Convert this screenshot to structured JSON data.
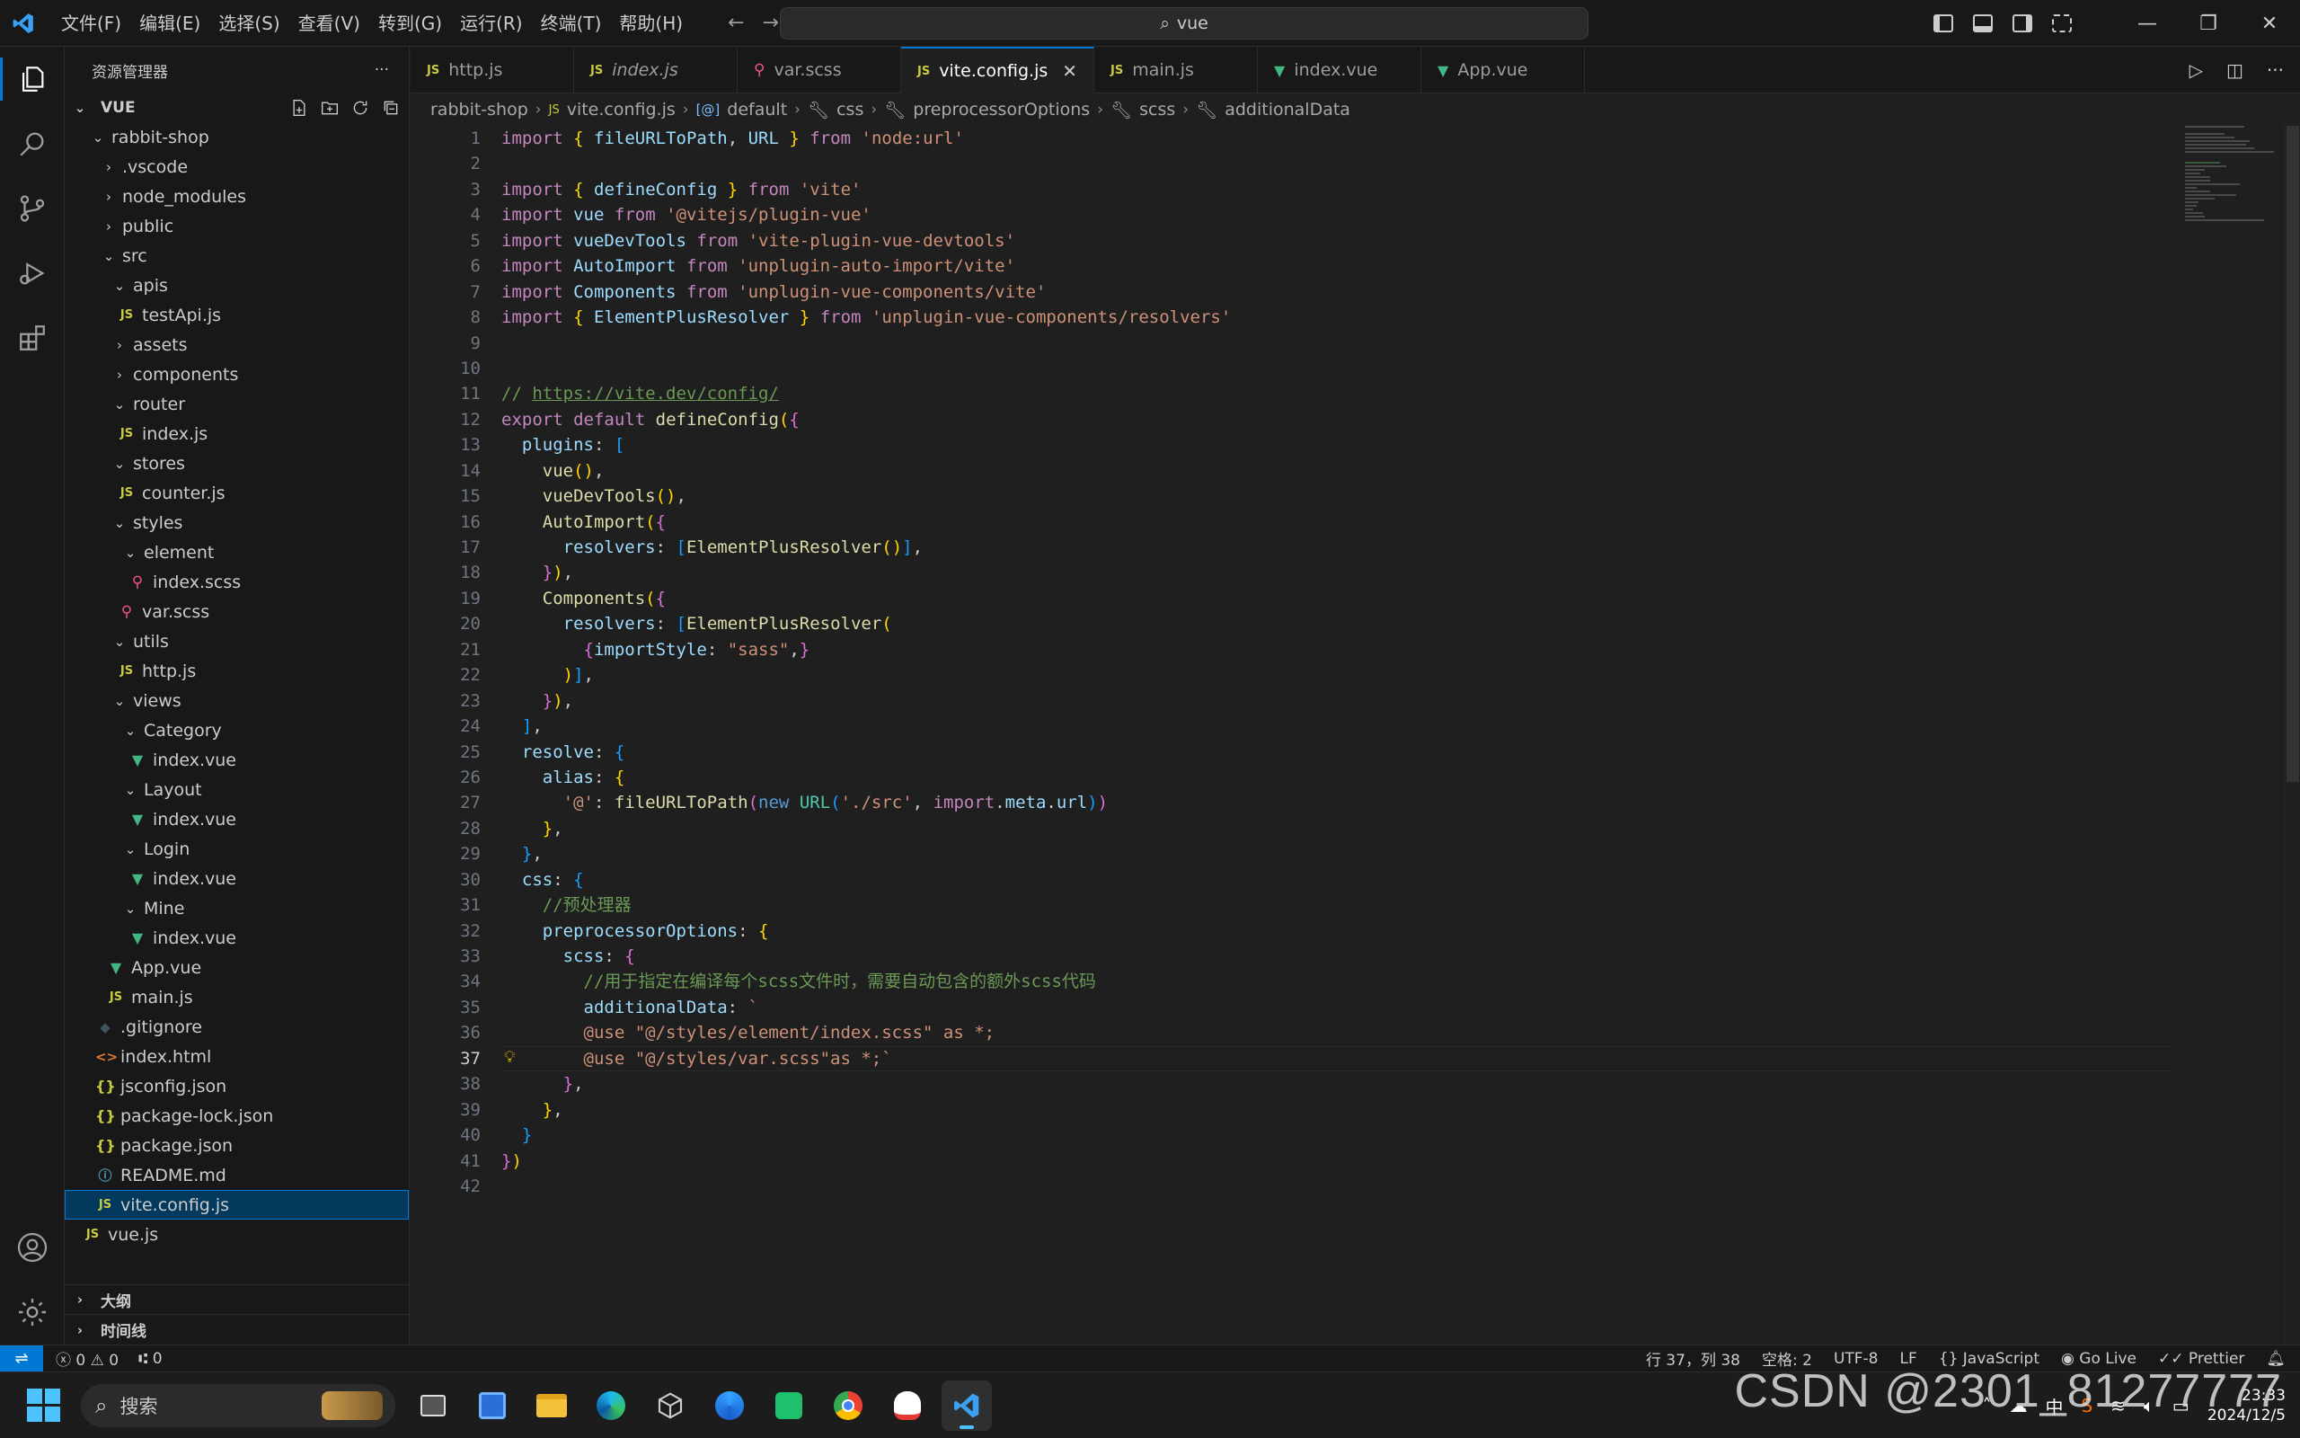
{
  "menu": [
    "文件(F)",
    "编辑(E)",
    "选择(S)",
    "查看(V)",
    "转到(G)",
    "运行(R)",
    "终端(T)",
    "帮助(H)"
  ],
  "search": {
    "text": "vue"
  },
  "sidebar": {
    "title": "资源管理器",
    "section": "VUE",
    "tree": [
      {
        "label": "rabbit-shop",
        "indent": 1,
        "type": "folder-open"
      },
      {
        "label": ".vscode",
        "indent": 2,
        "type": "folder"
      },
      {
        "label": "node_modules",
        "indent": 2,
        "type": "folder"
      },
      {
        "label": "public",
        "indent": 2,
        "type": "folder"
      },
      {
        "label": "src",
        "indent": 2,
        "type": "folder-open"
      },
      {
        "label": "apis",
        "indent": 3,
        "type": "folder-open"
      },
      {
        "label": "testApi.js",
        "indent": 3,
        "type": "js"
      },
      {
        "label": "assets",
        "indent": 3,
        "type": "folder"
      },
      {
        "label": "components",
        "indent": 3,
        "type": "folder"
      },
      {
        "label": "router",
        "indent": 3,
        "type": "folder-open"
      },
      {
        "label": "index.js",
        "indent": 3,
        "type": "js"
      },
      {
        "label": "stores",
        "indent": 3,
        "type": "folder-open"
      },
      {
        "label": "counter.js",
        "indent": 3,
        "type": "js"
      },
      {
        "label": "styles",
        "indent": 3,
        "type": "folder-open"
      },
      {
        "label": "element",
        "indent": 4,
        "type": "folder-open"
      },
      {
        "label": "index.scss",
        "indent": 4,
        "type": "scss"
      },
      {
        "label": "var.scss",
        "indent": 3,
        "type": "scss"
      },
      {
        "label": "utils",
        "indent": 3,
        "type": "folder-open"
      },
      {
        "label": "http.js",
        "indent": 3,
        "type": "js"
      },
      {
        "label": "views",
        "indent": 3,
        "type": "folder-open"
      },
      {
        "label": "Category",
        "indent": 4,
        "type": "folder-open"
      },
      {
        "label": "index.vue",
        "indent": 4,
        "type": "vue"
      },
      {
        "label": "Layout",
        "indent": 4,
        "type": "folder-open"
      },
      {
        "label": "index.vue",
        "indent": 4,
        "type": "vue"
      },
      {
        "label": "Login",
        "indent": 4,
        "type": "folder-open"
      },
      {
        "label": "index.vue",
        "indent": 4,
        "type": "vue"
      },
      {
        "label": "Mine",
        "indent": 4,
        "type": "folder-open"
      },
      {
        "label": "index.vue",
        "indent": 4,
        "type": "vue"
      },
      {
        "label": "App.vue",
        "indent": 2,
        "type": "vue"
      },
      {
        "label": "main.js",
        "indent": 2,
        "type": "js"
      },
      {
        "label": ".gitignore",
        "indent": 1,
        "type": "git"
      },
      {
        "label": "index.html",
        "indent": 1,
        "type": "html"
      },
      {
        "label": "jsconfig.json",
        "indent": 1,
        "type": "json"
      },
      {
        "label": "package-lock.json",
        "indent": 1,
        "type": "json"
      },
      {
        "label": "package.json",
        "indent": 1,
        "type": "json"
      },
      {
        "label": "README.md",
        "indent": 1,
        "type": "md"
      },
      {
        "label": "vite.config.js",
        "indent": 1,
        "type": "js",
        "selected": true
      },
      {
        "label": "vue.js",
        "indent": 0,
        "type": "js"
      }
    ],
    "bottom_sections": [
      "大纲",
      "时间线"
    ]
  },
  "tabs": [
    {
      "label": "http.js",
      "icon": "JS",
      "italic": false
    },
    {
      "label": "index.js",
      "icon": "JS",
      "italic": true
    },
    {
      "label": "var.scss",
      "icon": "scss",
      "italic": false
    },
    {
      "label": "vite.config.js",
      "icon": "JS",
      "italic": false,
      "active": true
    },
    {
      "label": "main.js",
      "icon": "JS",
      "italic": false
    },
    {
      "label": "index.vue",
      "icon": "vue",
      "italic": false
    },
    {
      "label": "App.vue",
      "icon": "vue",
      "italic": false
    }
  ],
  "breadcrumb": [
    "rabbit-shop",
    "vite.config.js",
    "default",
    "css",
    "preprocessorOptions",
    "scss",
    "additionalData"
  ],
  "editor": {
    "current_line": 37,
    "line_count": 42
  },
  "status": {
    "errors": "0",
    "warnings": "0",
    "ports": "0",
    "position": "行 37，列 38",
    "indent": "空格: 2",
    "encoding": "UTF-8",
    "eol": "LF",
    "language": "JavaScript",
    "golive": "Go Live",
    "prettier": "Prettier"
  },
  "taskbar": {
    "search_placeholder": "搜索",
    "time": "23:33",
    "date": "2024/12/5",
    "ime": "中"
  },
  "watermark": "CSDN @2301_81277777",
  "colors": {
    "accent": "#0078d4",
    "selection": "#04395e"
  }
}
